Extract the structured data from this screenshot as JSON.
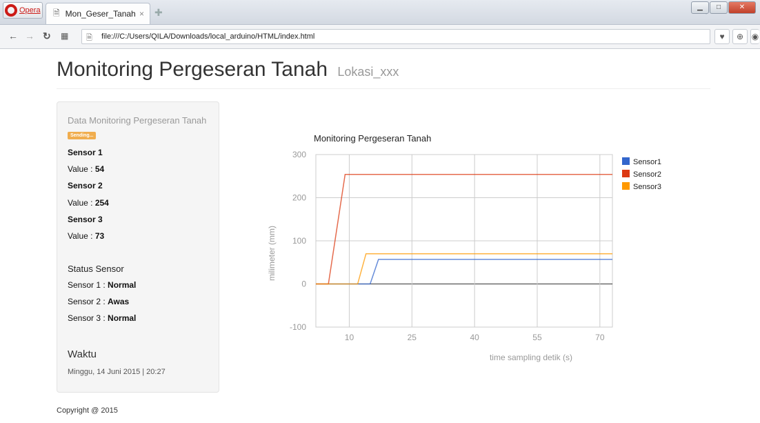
{
  "browser": {
    "opera_label": "Opera",
    "tab_title": "Mon_Geser_Tanah",
    "tab_close": "×",
    "url": "file:///C:/Users/QILA/Downloads/local_arduino/HTML/index.html"
  },
  "page": {
    "title": "Monitoring Pergeseran Tanah",
    "subtitle": "Lokasi_xxx",
    "copyright": "Copyright @ 2015"
  },
  "panel": {
    "heading": "Data Monitoring Pergeseran Tanah",
    "badge": "Sending...",
    "sensors": [
      {
        "name": "Sensor 1",
        "value_label": "Value : ",
        "value": "54"
      },
      {
        "name": "Sensor 2",
        "value_label": "Value : ",
        "value": "254"
      },
      {
        "name": "Sensor 3",
        "value_label": "Value : ",
        "value": "73"
      }
    ],
    "status_heading": "Status Sensor",
    "statuses": [
      {
        "label": "Sensor 1 : ",
        "status": "Normal"
      },
      {
        "label": "Sensor 2 : ",
        "status": "Awas"
      },
      {
        "label": "Sensor 3 : ",
        "status": "Normal"
      }
    ],
    "time_heading": "Waktu",
    "time_value": "Minggu, 14 Juni 2015 | 20:27"
  },
  "chart_data": {
    "type": "line",
    "title": "Monitoring Pergeseran Tanah",
    "xlabel": "time sampling detik (s)",
    "ylabel": "milimeter (mm)",
    "xlim": [
      2,
      73
    ],
    "ylim": [
      -100,
      300
    ],
    "xticks": [
      10,
      25,
      40,
      55,
      70
    ],
    "yticks": [
      300,
      200,
      100,
      0,
      -100
    ],
    "grid": true,
    "legend_position": "right",
    "series": [
      {
        "name": "Sensor1",
        "color": "#3366cc",
        "points": [
          [
            2,
            0
          ],
          [
            15,
            0
          ],
          [
            17,
            57
          ],
          [
            73,
            57
          ]
        ]
      },
      {
        "name": "Sensor2",
        "color": "#dc3912",
        "points": [
          [
            2,
            0
          ],
          [
            5,
            0
          ],
          [
            9,
            254
          ],
          [
            73,
            254
          ]
        ]
      },
      {
        "name": "Sensor3",
        "color": "#ff9900",
        "points": [
          [
            2,
            0
          ],
          [
            12,
            0
          ],
          [
            14,
            70
          ],
          [
            73,
            70
          ]
        ]
      }
    ]
  }
}
